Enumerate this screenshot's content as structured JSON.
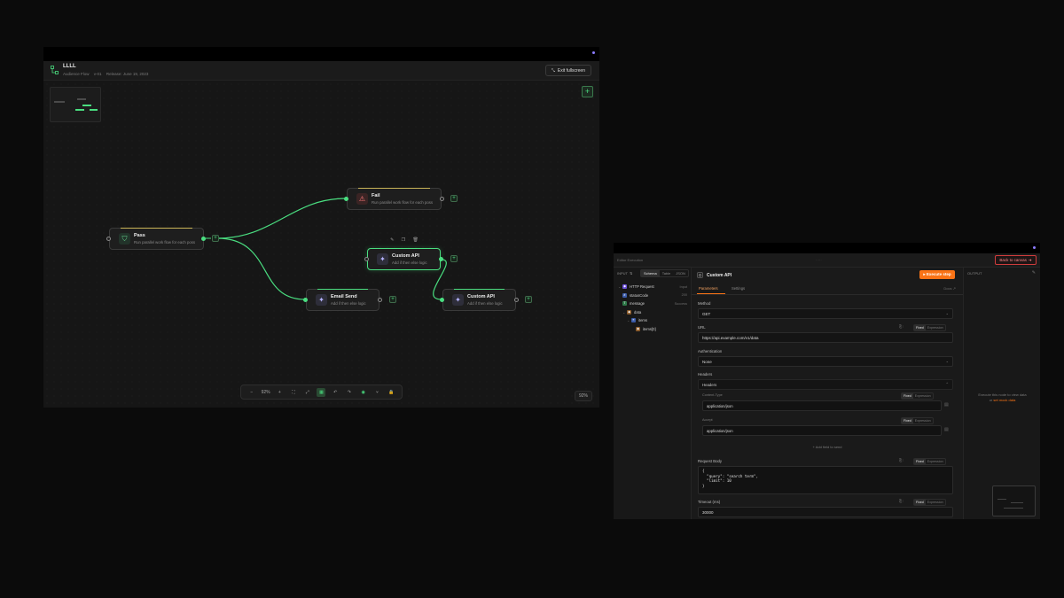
{
  "workflow": {
    "title": "LLLL",
    "subtitle": "Audience Flow",
    "version": "v-01",
    "release": "Release: June 19, 2023",
    "exit_label": "Exit fullscreen",
    "zoom_value": "92%",
    "zoom_badge": "92%",
    "accent_color": "#4ade80",
    "nodes": [
      {
        "title": "Pass",
        "desc": "Run parallel work flow for each poss",
        "icon": "shield-icon"
      },
      {
        "title": "Fail",
        "desc": "Run parallel work flow for each poss",
        "icon": "alert-icon"
      },
      {
        "title": "Custom API",
        "desc": "Add if then else logic",
        "icon": "star-icon"
      },
      {
        "title": "Email Send",
        "desc": "Add if then else logic",
        "icon": "star-icon"
      },
      {
        "title": "Custom API",
        "desc": "Add if then else logic",
        "icon": "star-icon"
      }
    ]
  },
  "editor": {
    "breadcrumb": "Editor Execution",
    "back_label": "Back to canvas",
    "input": {
      "label": "INPUT",
      "tabs": [
        "Schema",
        "Table",
        "JSON"
      ],
      "active_tab": "Schema",
      "tree": [
        {
          "key": "HTTP Request",
          "value": "Input",
          "type": "object"
        },
        {
          "key": "statusCode",
          "value": "200",
          "type": "number"
        },
        {
          "key": "message",
          "value": "Success",
          "type": "string"
        },
        {
          "key": "data",
          "value": "",
          "type": "object"
        },
        {
          "key": "items",
          "value": "",
          "type": "array"
        },
        {
          "key": "items[0]",
          "value": "",
          "type": "object"
        }
      ]
    },
    "params": {
      "node_title": "Custom API",
      "execute_label": "Execute step",
      "tabs": [
        "Parameters",
        "Settings"
      ],
      "docs_label": "Docs",
      "method_label": "Method",
      "method_value": "GET",
      "url_label": "URL",
      "url_value": "https://api.example.com/v1/data",
      "fixed_label": "Fixed",
      "expression_label": "Expression",
      "auth_label": "Authentication",
      "auth_value": "None",
      "headers_label": "Headers",
      "headers_box": "Headers",
      "content_type_label": "Content-Type",
      "content_type_value": "application/json",
      "accept_label": "Accept",
      "accept_value": "application/json",
      "add_field": "+ Add field to send",
      "body_label": "Request Body",
      "body_value": "{\n  \"query\": \"search term\",\n  \"limit\": 10\n}",
      "timeout_label": "Timeout (ms)",
      "timeout_value": "30000"
    },
    "output": {
      "label": "OUTPUT",
      "message": "Execute this node to view data",
      "or_text": "or",
      "mock_link": "set mock data"
    }
  }
}
